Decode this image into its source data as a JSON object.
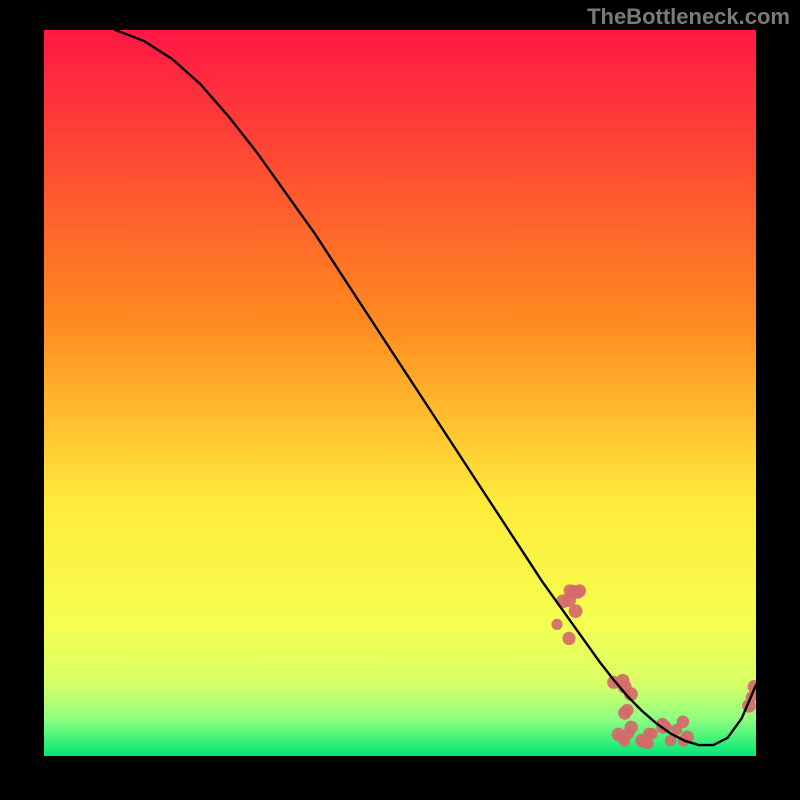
{
  "watermark": "TheBottleneck.com",
  "chart_data": {
    "type": "line",
    "title": "",
    "xlabel": "",
    "ylabel": "",
    "xlim": [
      0,
      100
    ],
    "ylim": [
      0,
      100
    ],
    "curve": {
      "x": [
        10,
        14,
        18,
        22,
        26,
        30,
        34,
        38,
        42,
        46,
        50,
        54,
        58,
        62,
        66,
        70,
        74,
        78,
        80,
        82,
        84,
        86,
        88,
        90,
        92,
        94,
        96,
        98,
        100
      ],
      "y": [
        100,
        98.5,
        96,
        92.5,
        88,
        83,
        77.5,
        72,
        66,
        60,
        54,
        48,
        42,
        36,
        30,
        24,
        18.5,
        13,
        10.5,
        8.2,
        6.2,
        4.5,
        3.1,
        2.1,
        1.5,
        1.5,
        2.5,
        5.2,
        9.8
      ]
    },
    "dot_clusters": [
      {
        "cx": 73.5,
        "cy": 19.5,
        "spread_x": 2.0,
        "spread_y": 4.5,
        "n": 9
      },
      {
        "cx": 85.0,
        "cy": 3.2,
        "spread_x": 6.0,
        "spread_y": 1.6,
        "n": 18
      },
      {
        "cx": 80.5,
        "cy": 8.0,
        "spread_x": 2.0,
        "spread_y": 2.5,
        "n": 6
      },
      {
        "cx": 99.0,
        "cy": 8.2,
        "spread_x": 1.0,
        "spread_y": 2.0,
        "n": 3
      }
    ],
    "colors": {
      "top": "#ff1744",
      "mid": "#ffeb3b",
      "bottom": "#00e676",
      "curve": "#000000",
      "dot": "#d46a6a"
    }
  }
}
